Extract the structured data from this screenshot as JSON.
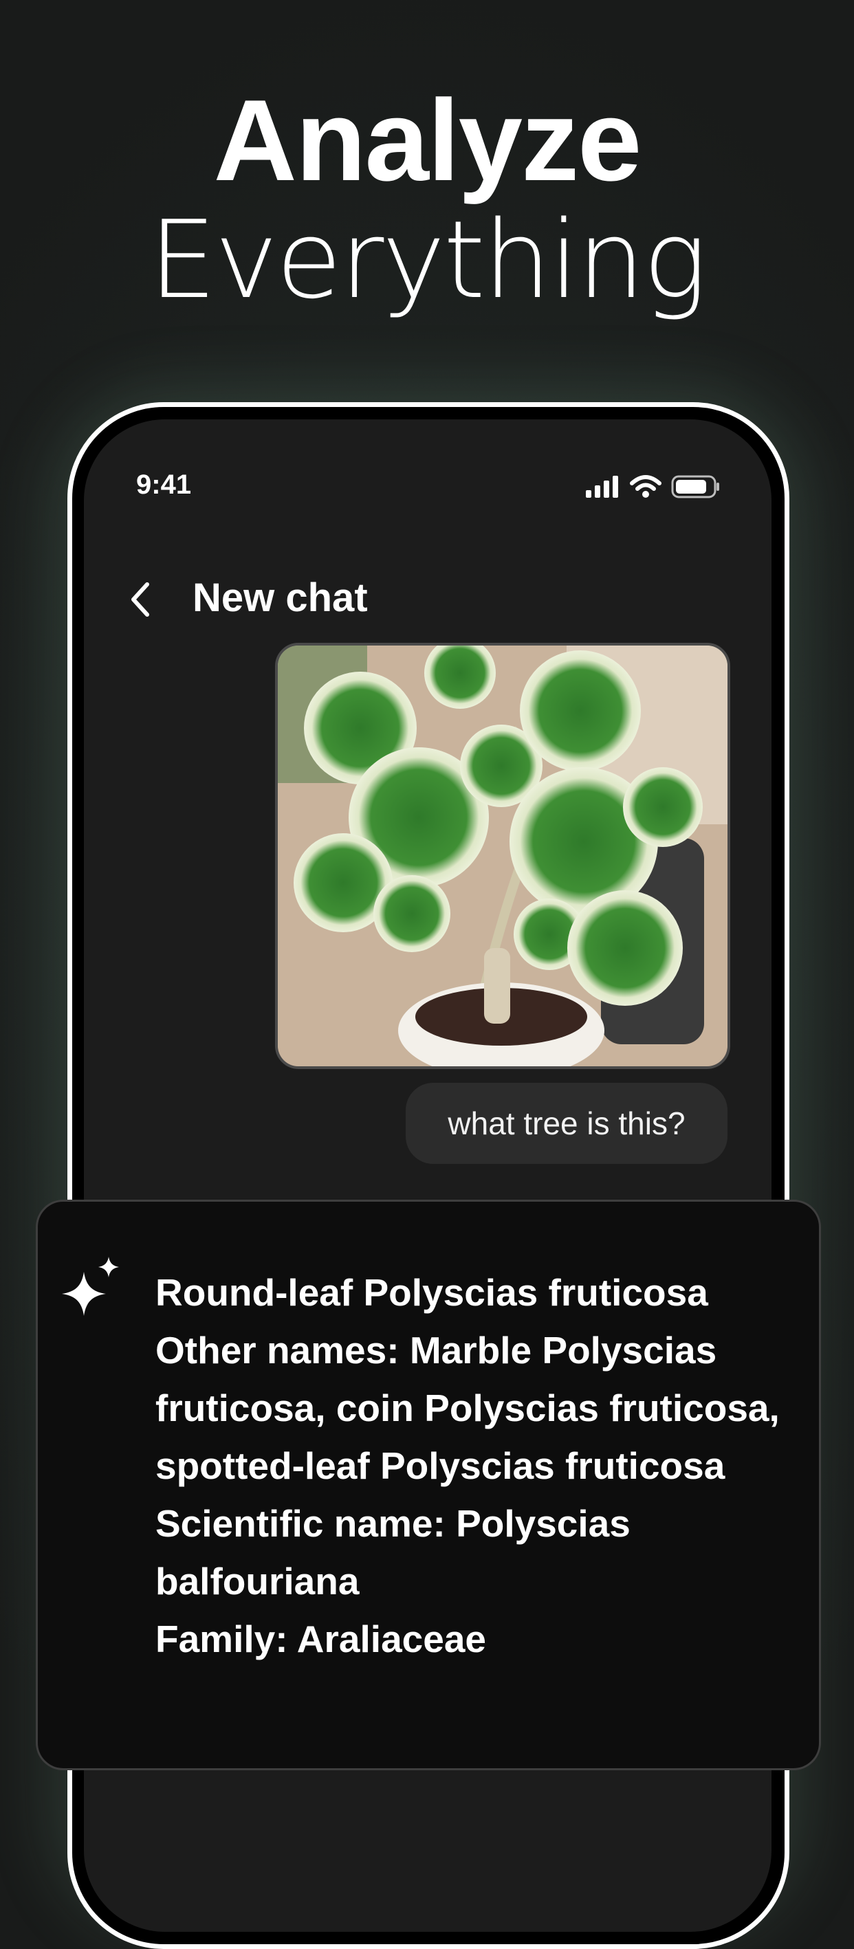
{
  "headline": {
    "line1": "Analyze",
    "line2": "Everything"
  },
  "status_bar": {
    "time": "9:41"
  },
  "nav": {
    "title": "New chat"
  },
  "message": {
    "user_text": "what tree is this?"
  },
  "answer": {
    "lines": [
      "Round-leaf Polyscias fruticosa",
      "Other names: Marble Polyscias fruticosa, coin Polyscias fruticosa, spotted-leaf Polyscias fruticosa",
      "Scientific name: Polyscias balfouriana",
      "Family: Araliaceae"
    ]
  },
  "icons": [
    "chevron-left-icon",
    "signal-icon",
    "wifi-icon",
    "battery-icon",
    "sparkle-icon"
  ],
  "colors": {
    "background": "#1c1f1e",
    "card": "#0d0d0d",
    "bubble": "#2c2c2c",
    "text": "#ffffff"
  }
}
